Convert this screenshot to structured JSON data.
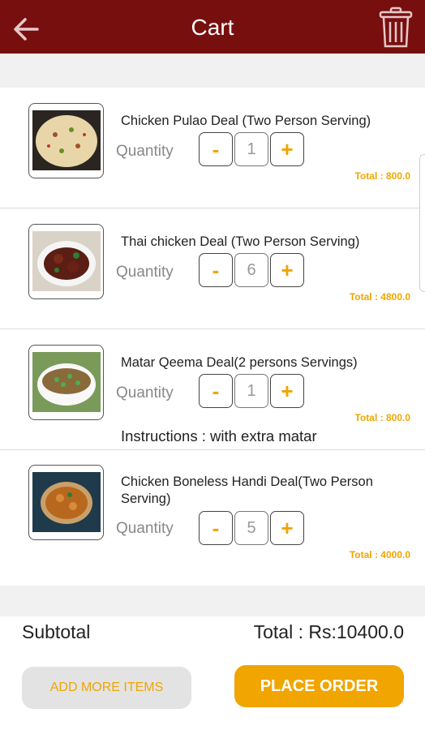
{
  "header": {
    "title": "Cart",
    "back_icon": "arrow-left-icon",
    "trash_icon": "trash-icon",
    "bg_color": "#780f0f"
  },
  "cart": {
    "items": [
      {
        "name": "Chicken Pulao Deal (Two Person Serving)",
        "quantity_label": "Quantity",
        "decrement": "-",
        "quantity": "1",
        "increment": "+",
        "total": "Total : 800.0"
      },
      {
        "name": "Thai chicken Deal (Two Person Serving)",
        "quantity_label": "Quantity",
        "decrement": "-",
        "quantity": "6",
        "increment": "+",
        "total": "Total : 4800.0"
      },
      {
        "name": "Matar Qeema Deal(2 persons  Servings)",
        "quantity_label": "Quantity",
        "decrement": "-",
        "quantity": "1",
        "increment": "+",
        "total": "Total : 800.0",
        "instructions": "Instructions : with extra matar"
      },
      {
        "name": "Chicken Boneless Handi Deal(Two Person Serving)",
        "quantity_label": "Quantity",
        "decrement": "-",
        "quantity": "5",
        "increment": "+",
        "total": "Total : 4000.0"
      }
    ]
  },
  "footer": {
    "subtotal_label": "Subtotal",
    "total": "Total : Rs:10400.0",
    "add_more_label": "ADD MORE ITEMS",
    "place_order_label": "PLACE ORDER"
  },
  "colors": {
    "accent": "#f0a500",
    "brand": "#780f0f"
  }
}
